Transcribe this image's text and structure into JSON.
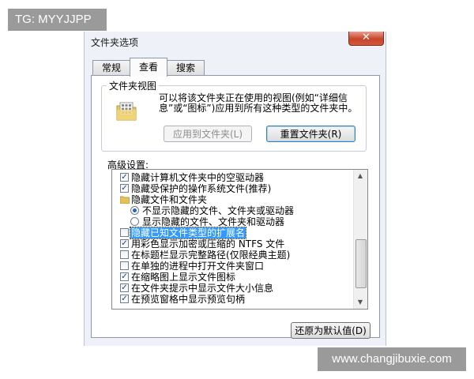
{
  "watermarks": {
    "top": "TG: MYYJJPP",
    "bottom": "www.changjibuxie.com"
  },
  "window": {
    "title": "文件夹选项",
    "close_label": "✕"
  },
  "tabs": [
    {
      "label": "常规",
      "active": false
    },
    {
      "label": "查看",
      "active": true
    },
    {
      "label": "搜索",
      "active": false
    }
  ],
  "folder_views": {
    "group_label": "文件夹视图",
    "description": "可以将该文件夹正在使用的视图(例如“详细信息”或“图标”)应用到所有这种类型的文件夹中。",
    "apply_button": "应用到文件夹(L)",
    "reset_button": "重置文件夹(R)"
  },
  "advanced": {
    "label": "高级设置:",
    "items": [
      {
        "type": "checkbox",
        "checked": true,
        "indent": 0,
        "label": "隐藏计算机文件夹中的空驱动器"
      },
      {
        "type": "checkbox",
        "checked": true,
        "indent": 0,
        "label": "隐藏受保护的操作系统文件(推荐)"
      },
      {
        "type": "folder",
        "indent": 0,
        "label": "隐藏文件和文件夹"
      },
      {
        "type": "radio",
        "checked": true,
        "indent": 1,
        "label": "不显示隐藏的文件、文件夹或驱动器"
      },
      {
        "type": "radio",
        "checked": false,
        "indent": 1,
        "label": "显示隐藏的文件、文件夹和驱动器"
      },
      {
        "type": "checkbox",
        "checked": false,
        "indent": 0,
        "label": "隐藏已知文件类型的扩展名",
        "selected": true
      },
      {
        "type": "checkbox",
        "checked": true,
        "indent": 0,
        "label": "用彩色显示加密或压缩的 NTFS 文件"
      },
      {
        "type": "checkbox",
        "checked": false,
        "indent": 0,
        "label": "在标题栏显示完整路径(仅限经典主题)"
      },
      {
        "type": "checkbox",
        "checked": false,
        "indent": 0,
        "label": "在单独的进程中打开文件夹窗口"
      },
      {
        "type": "checkbox",
        "checked": true,
        "indent": 0,
        "label": "在缩略图上显示文件图标"
      },
      {
        "type": "checkbox",
        "checked": true,
        "indent": 0,
        "label": "在文件夹提示中显示文件大小信息"
      },
      {
        "type": "checkbox",
        "checked": true,
        "indent": 0,
        "label": "在预览窗格中显示预览句柄"
      }
    ],
    "restore_button": "还原为默认值(D)"
  }
}
